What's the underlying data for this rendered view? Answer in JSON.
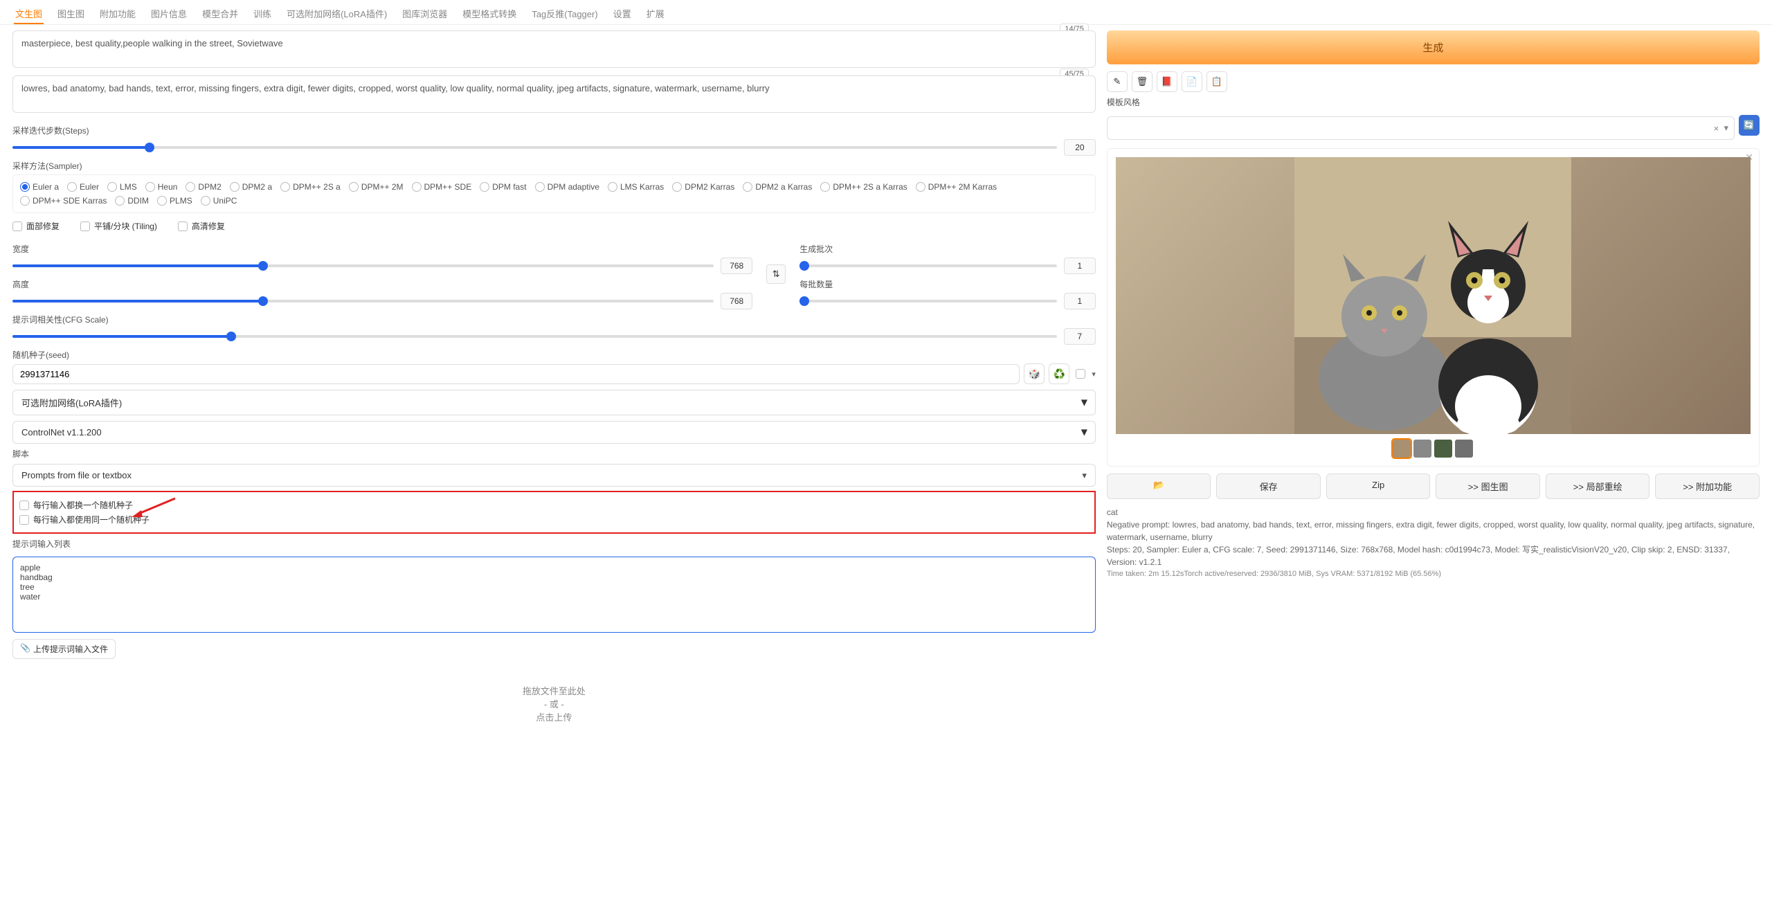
{
  "tabs": [
    "文生图",
    "图生图",
    "附加功能",
    "图片信息",
    "模型合并",
    "训练",
    "可选附加网络(LoRA插件)",
    "图库浏览器",
    "模型格式转换",
    "Tag反推(Tagger)",
    "设置",
    "扩展"
  ],
  "activeTab": 0,
  "prompt": {
    "token_count": "14/75",
    "text": "masterpiece, best quality,people walking in the street, Sovietwave"
  },
  "neg_prompt": {
    "token_count": "45/75",
    "text": "lowres, bad anatomy, bad hands, text, error, missing fingers, extra digit, fewer digits, cropped, worst quality, low quality, normal quality, jpeg artifacts, signature, watermark, username, blurry"
  },
  "steps": {
    "label": "采样迭代步数(Steps)",
    "value": "20"
  },
  "sampler": {
    "label": "采样方法(Sampler)",
    "options": [
      "Euler a",
      "Euler",
      "LMS",
      "Heun",
      "DPM2",
      "DPM2 a",
      "DPM++ 2S a",
      "DPM++ 2M",
      "DPM++ SDE",
      "DPM fast",
      "DPM adaptive",
      "LMS Karras",
      "DPM2 Karras",
      "DPM2 a Karras",
      "DPM++ 2S a Karras",
      "DPM++ 2M Karras",
      "DPM++ SDE Karras",
      "DDIM",
      "PLMS",
      "UniPC"
    ],
    "selected": "Euler a"
  },
  "checks": {
    "face": "面部修复",
    "tiling": "平铺/分块 (Tiling)",
    "hires": "高清修复"
  },
  "width": {
    "label": "宽度",
    "value": "768"
  },
  "height": {
    "label": "高度",
    "value": "768"
  },
  "batch_count": {
    "label": "生成批次",
    "value": "1"
  },
  "batch_size": {
    "label": "每批数量",
    "value": "1"
  },
  "cfg": {
    "label": "提示词相关性(CFG Scale)",
    "value": "7"
  },
  "seed": {
    "label": "随机种子(seed)",
    "value": "2991371146",
    "dice_icon": "🎲",
    "recycle_icon": "♻️"
  },
  "accordions": [
    "可选附加网络(LoRA插件)",
    "ControlNet v1.1.200"
  ],
  "script": {
    "label": "脚本",
    "value": "Prompts from file or textbox"
  },
  "script_checks": [
    "每行输入都换一个随机种子",
    "每行输入都使用同一个随机种子"
  ],
  "prompt_list": {
    "label": "提示词输入列表",
    "value": "apple\nhandbag\ntree\nwater"
  },
  "upload_label": "上传提示词输入文件",
  "dropzone": {
    "l1": "拖放文件至此处",
    "l2": "- 或 -",
    "l3": "点击上传"
  },
  "gen_btn": "生成",
  "tool_icons": [
    "✎",
    "🗑",
    "📕",
    "📄",
    "📋"
  ],
  "style": {
    "label": "模板风格",
    "clear": "×",
    "caret": "▾",
    "refresh": "🔄"
  },
  "output_buttons": [
    {
      "icon": "📂",
      "label": ""
    },
    {
      "label": "保存"
    },
    {
      "label": "Zip"
    },
    {
      "label": ">> 图生图"
    },
    {
      "label": ">> 局部重绘"
    },
    {
      "label": ">> 附加功能"
    }
  ],
  "info": {
    "prompt": "cat",
    "neg": "Negative prompt: lowres, bad anatomy, bad hands, text, error, missing fingers, extra digit, fewer digits, cropped, worst quality, low quality, normal quality, jpeg artifacts, signature, watermark, username, blurry",
    "params": "Steps: 20, Sampler: Euler a, CFG scale: 7, Seed: 2991371146, Size: 768x768, Model hash: c0d1994c73, Model: 写实_realisticVisionV20_v20, Clip skip: 2, ENSD: 31337, Version: v1.2.1",
    "time": "Time taken: 2m 15.12sTorch active/reserved: 2936/3810 MiB, Sys VRAM: 5371/8192 MiB (65.56%)"
  }
}
